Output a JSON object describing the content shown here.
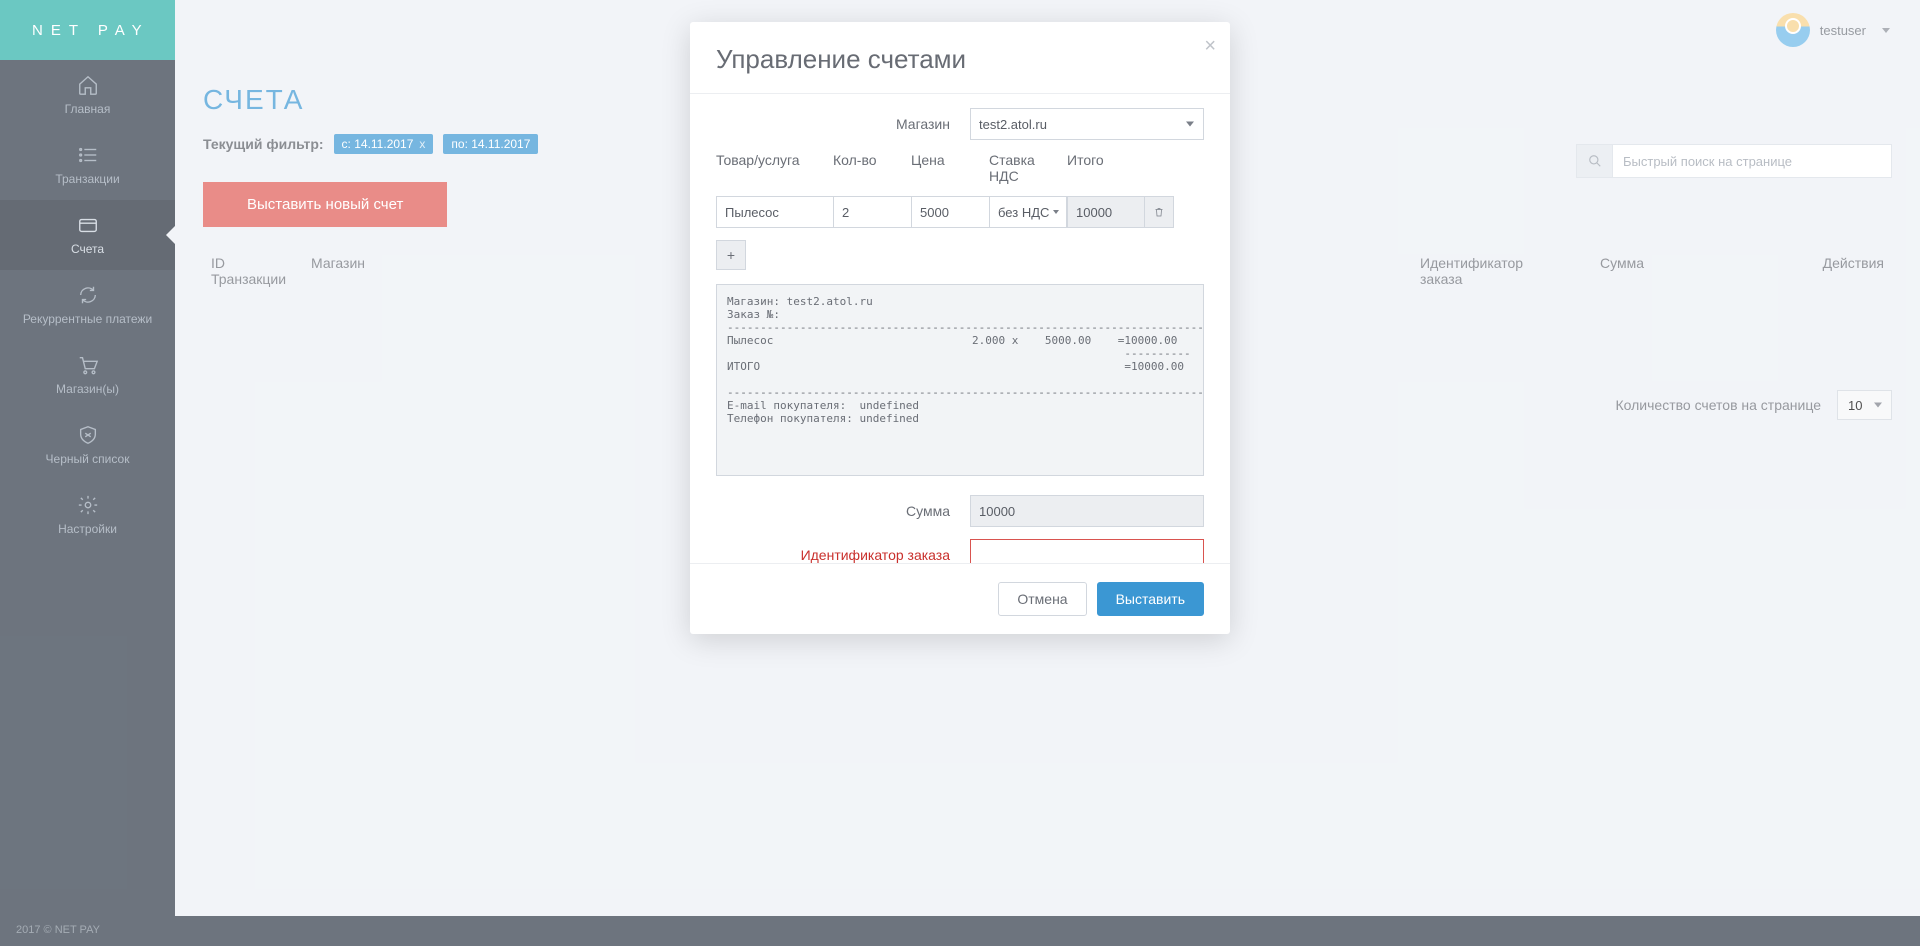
{
  "brand": "NET PAY",
  "user": {
    "name": "testuser"
  },
  "sidebar": {
    "items": [
      {
        "label": "Главная",
        "key": "home"
      },
      {
        "label": "Транзакции",
        "key": "transactions"
      },
      {
        "label": "Счета",
        "key": "invoices",
        "active": true
      },
      {
        "label": "Рекуррентные платежи",
        "key": "recurrent"
      },
      {
        "label": "Магазин(ы)",
        "key": "shops"
      },
      {
        "label": "Черный список",
        "key": "blacklist"
      },
      {
        "label": "Настройки",
        "key": "settings"
      }
    ]
  },
  "page": {
    "title": "СЧЕТА",
    "filter_label": "Текущий фильтр:",
    "chips": [
      {
        "text": "с: 14.11.2017"
      },
      {
        "text": "по: 14.11.2017"
      }
    ],
    "search_placeholder": "Быстрый поиск на странице",
    "new_invoice_btn": "Выставить новый счет",
    "columns": {
      "c1a": "ID",
      "c1b": "Транзакции",
      "c2": "Магазин",
      "c4a": "Идентификатор",
      "c4b": "заказа",
      "c5": "Сумма",
      "c6": "Действия"
    },
    "per_page_label": "Количество счетов на странице",
    "per_page_value": "10"
  },
  "footer": "2017 © NET PAY",
  "modal": {
    "title": "Управление счетами",
    "close": "×",
    "shop_label": "Магазин",
    "shop_value": "test2.atol.ru",
    "grid_head": {
      "product": "Товар/услуга",
      "qty": "Кол-во",
      "price": "Цена",
      "vat1": "Ставка",
      "vat2": "НДС",
      "total": "Итого"
    },
    "row": {
      "product": "Пылесос",
      "qty": "2",
      "price": "5000",
      "vat": "без НДС",
      "total": "10000"
    },
    "add_btn": "+",
    "preview": "Магазин: test2.atol.ru\nЗаказ №:\n------------------------------------------------------------------------------\nПылесос                              2.000 x    5000.00    =10000.00\n                                                            ----------\nИТОГО                                                       =10000.00\n\n------------------------------------------------------------------------------\nE-mail покупателя:  undefined\nТелефон покупателя: undefined",
    "sum_label": "Сумма",
    "sum_value": "10000",
    "order_id_label": "Идентификатор заказа",
    "order_id_value": "",
    "cancel": "Отмена",
    "submit": "Выставить"
  }
}
